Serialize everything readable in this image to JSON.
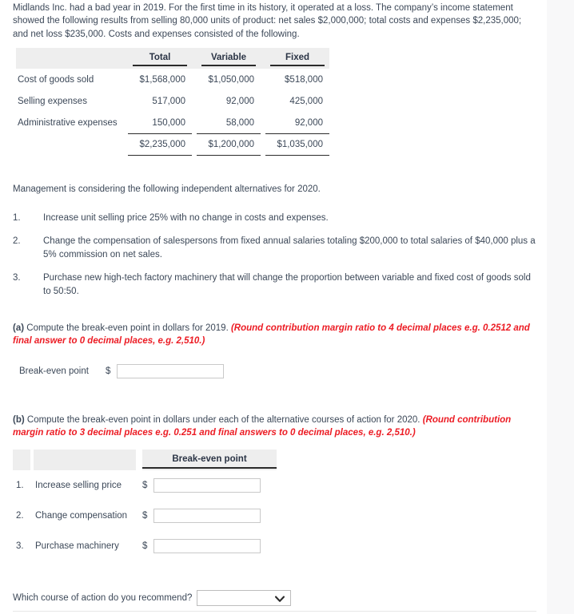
{
  "intro": {
    "paragraph": "Midlands Inc. had a bad year in 2019. For the first time in its history, it operated at a loss. The company’s income statement showed the following results from selling 80,000 units of product: net sales $2,000,000; total costs and expenses $2,235,000; and net loss $235,000. Costs and expenses consisted of the following."
  },
  "cost_table": {
    "headers": [
      "",
      "Total",
      "Variable",
      "Fixed"
    ],
    "rows": [
      {
        "label": "Cost of goods sold",
        "total": "$1,568,000",
        "variable": "$1,050,000",
        "fixed": "$518,000"
      },
      {
        "label": "Selling expenses",
        "total": "517,000",
        "variable": "92,000",
        "fixed": "425,000"
      },
      {
        "label": "Administrative expenses",
        "total": "150,000",
        "variable": "58,000",
        "fixed": "92,000"
      }
    ],
    "total_row": {
      "label": "",
      "total": "$2,235,000",
      "variable": "$1,200,000",
      "fixed": "$1,035,000"
    }
  },
  "management": {
    "lead": "Management is considering the following independent alternatives for 2020.",
    "alternatives": [
      {
        "num": "1.",
        "text": "Increase unit selling price 25% with no change in costs and expenses."
      },
      {
        "num": "2.",
        "text": "Change the compensation of salespersons from fixed annual salaries totaling $200,000 to total salaries of $40,000 plus a 5% commission on net sales."
      },
      {
        "num": "3.",
        "text": "Purchase new high-tech factory machinery that will change the proportion between variable and fixed cost of goods sold to 50:50."
      }
    ]
  },
  "part_a": {
    "label": "(a)",
    "prompt": " Compute the break-even point in dollars for 2019. ",
    "hint": "(Round contribution margin ratio to 4 decimal places e.g. 0.2512 and final answer to 0 decimal places, e.g. 2,510.)",
    "row_label": "Break-even point",
    "currency": "$",
    "input_value": "",
    "input_placeholder": ""
  },
  "part_b": {
    "label": "(b)",
    "prompt": " Compute the break-even point in dollars under each of the alternative courses of action for 2020. ",
    "hint": "(Round contribution margin ratio to 3 decimal places e.g. 0.251 and final answers to 0 decimal places, e.g. 2,510.)",
    "column_header": "Break-even point",
    "rows": [
      {
        "num": "1.",
        "name": "Increase selling price",
        "currency": "$",
        "value": "",
        "placeholder": ""
      },
      {
        "num": "2.",
        "name": "Change compensation",
        "currency": "$",
        "value": "",
        "placeholder": ""
      },
      {
        "num": "3.",
        "name": "Purchase machinery",
        "currency": "$",
        "value": "",
        "placeholder": ""
      }
    ]
  },
  "recommend": {
    "label": "Which course of action do you recommend?",
    "selected": "",
    "icon": "chevron-down-icon"
  },
  "colors": {
    "hint_red": "#ec1c24",
    "text": "#3c4858",
    "header_gray": "#eeeeee",
    "page_bg": "#f8f8f9",
    "rule": "#2b2b2b"
  }
}
